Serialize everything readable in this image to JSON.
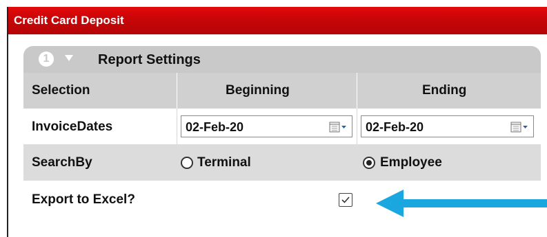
{
  "window": {
    "title": "Credit Card Deposit"
  },
  "section": {
    "step_number": "1",
    "title": "Report Settings"
  },
  "table": {
    "headers": [
      "Selection",
      "Beginning",
      "Ending"
    ],
    "invoice_dates": {
      "label": "InvoiceDates",
      "beginning": "02-Feb-20",
      "ending": "02-Feb-20"
    },
    "search_by": {
      "label": "SearchBy",
      "options": [
        {
          "label": "Terminal",
          "selected": false
        },
        {
          "label": "Employee",
          "selected": true
        }
      ]
    },
    "export": {
      "label": "Export to Excel?",
      "checked": true
    }
  },
  "colors": {
    "header_red": "#c70608",
    "section_gray": "#c9c9c9",
    "arrow_blue": "#1aa7e0"
  },
  "icons": [
    "collapse-arrow-icon",
    "calendar-icon",
    "checkmark-icon",
    "pointer-arrow-icon"
  ]
}
